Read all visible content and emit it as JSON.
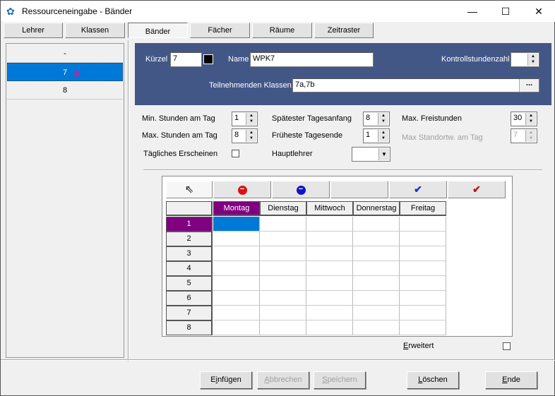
{
  "window": {
    "title": "Ressourceneingabe - Bänder",
    "minimize": "—",
    "maximize": "☐",
    "close": "✕"
  },
  "tabs": [
    "Lehrer",
    "Klassen",
    "Bänder",
    "Fächer",
    "Räume",
    "Zeitraster"
  ],
  "list": [
    "-",
    "7",
    "8"
  ],
  "header": {
    "kuerzel_label": "Kürzel",
    "kuerzel_value": "7",
    "name_label": "Name",
    "name_value": "WPK7",
    "kontroll_label": "Kontrollstundenzahl",
    "kontroll_value": "",
    "klassen_label": "Teilnehmenden Klassen:",
    "klassen_value": "7a,7b",
    "browse": "..."
  },
  "settings": {
    "min_label": "Min. Stunden am Tag",
    "min_value": "1",
    "max_label": "Max. Stunden am Tag",
    "max_value": "8",
    "taeglich_label": "Tägliches Erscheinen",
    "spaet_label": "Spätester Tagesanfang",
    "spaet_value": "8",
    "frueh_label": "Früheste Tagesende",
    "frueh_value": "1",
    "haupt_label": "Hauptlehrer",
    "haupt_value": "",
    "frei_label": "Max. Freistunden",
    "frei_value": "30",
    "standort_label": "Max Standortw. am Tag",
    "standort_value": "7"
  },
  "grid": {
    "days": [
      "Montag",
      "Dienstag",
      "Mittwoch",
      "Donnerstag",
      "Freitag"
    ],
    "periods": [
      "1",
      "2",
      "3",
      "4",
      "5",
      "6",
      "7",
      "8"
    ],
    "selected_day": "Montag",
    "selected_period": "1",
    "tools": [
      "pointer-icon",
      "red-minus-icon",
      "blue-minus-icon",
      "empty",
      "blue-check-icon",
      "red-check-icon"
    ]
  },
  "erweitert": {
    "pre": "",
    "acc": "E",
    "post": "rweitert"
  },
  "buttons": [
    {
      "pre": "E",
      "acc": "i",
      "post": "nfügen",
      "enabled": true
    },
    {
      "pre": "",
      "acc": "A",
      "post": "bbrechen",
      "enabled": false
    },
    {
      "pre": "",
      "acc": "S",
      "post": "peichern",
      "enabled": false
    },
    {
      "pre": "",
      "acc": "L",
      "post": "öschen",
      "enabled": true
    },
    {
      "pre": "",
      "acc": "E",
      "post": "nde",
      "enabled": true
    }
  ],
  "colors": {
    "accent": "#0078d7",
    "panel": "#435787",
    "purple": "#800080"
  }
}
